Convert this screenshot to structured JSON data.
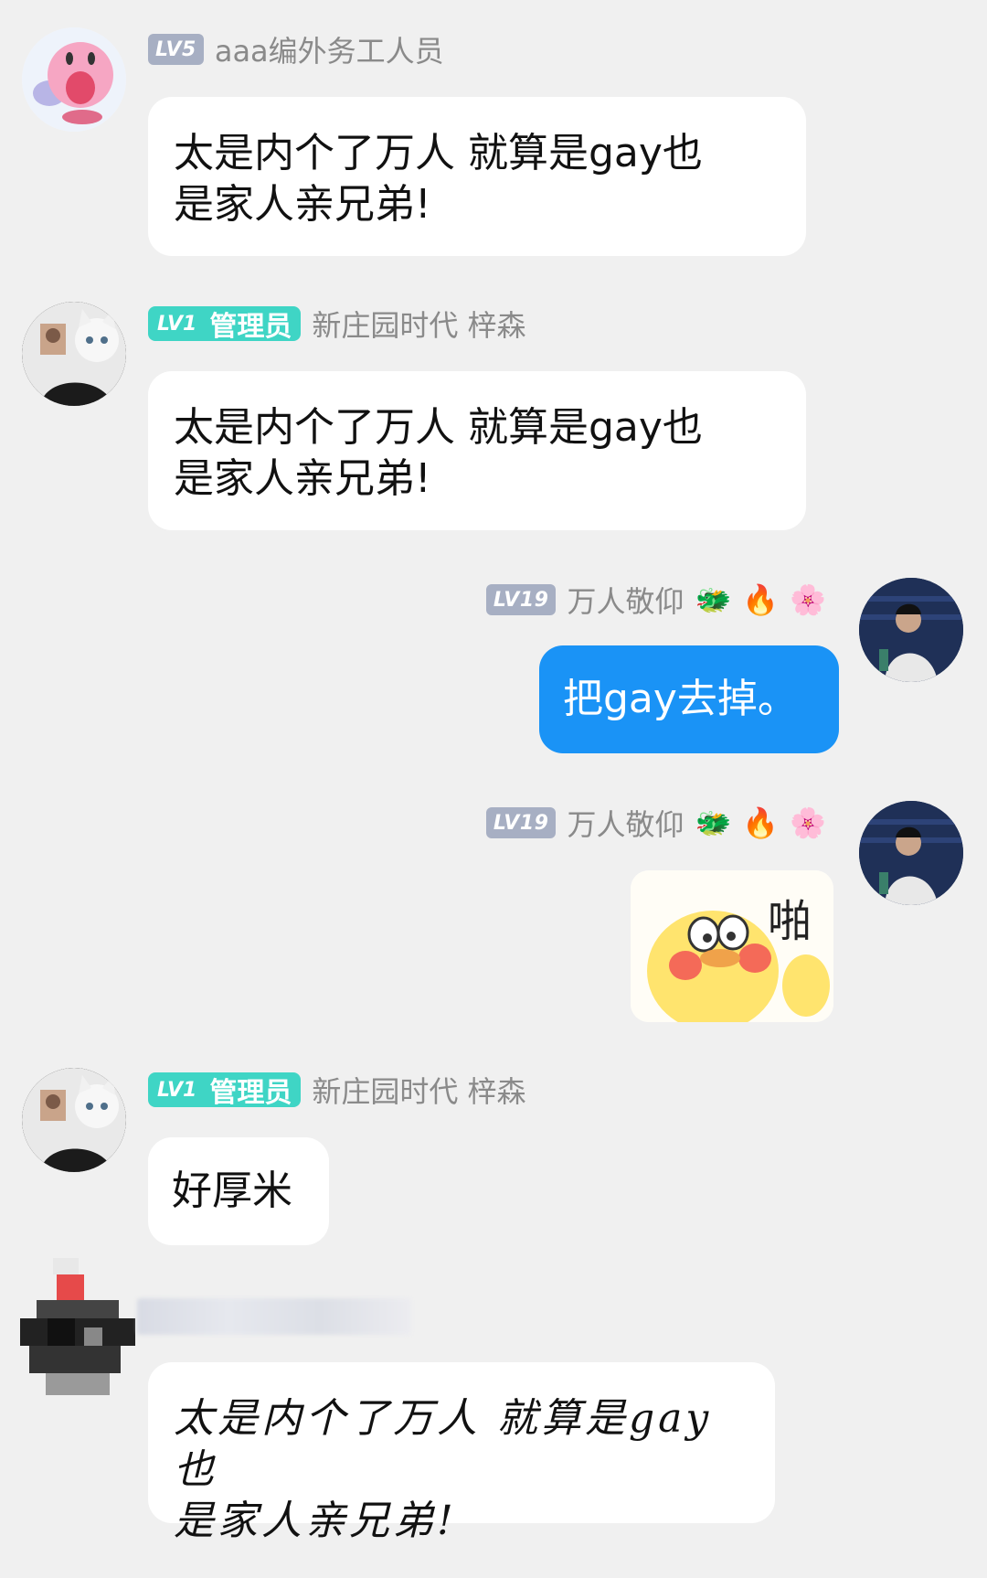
{
  "messages": [
    {
      "level": "LV5",
      "name": "aaa编外务工人员",
      "text_line1": "太是内个了万人 就算是gay也",
      "text_line2": "是家人亲兄弟!"
    },
    {
      "level": "LV1",
      "role": "管理员",
      "name": "新庄园时代 梓森",
      "text_line1": "太是内个了万人 就算是gay也",
      "text_line2": "是家人亲兄弟!"
    },
    {
      "level": "LV19",
      "name": "万人敬仰",
      "badges": [
        "dragon-icon",
        "fire-icon",
        "flower-icon"
      ],
      "text": "把gay去掉。"
    },
    {
      "level": "LV19",
      "name": "万人敬仰",
      "badges": [
        "dragon-icon",
        "fire-icon",
        "flower-icon"
      ],
      "sticker_text": "啪"
    },
    {
      "level": "LV1",
      "role": "管理员",
      "name": "新庄园时代 梓森",
      "text": "好厚米"
    },
    {
      "text_line1": "太是内个了万人 就算是gay也",
      "text_line2": "是家人亲兄弟!"
    }
  ],
  "colors": {
    "background": "#f0f0f0",
    "bubble": "#ffffff",
    "self_bubble": "#1a93f6",
    "admin_tag": "#3fd5c5",
    "level_badge": "#a7afc3"
  }
}
